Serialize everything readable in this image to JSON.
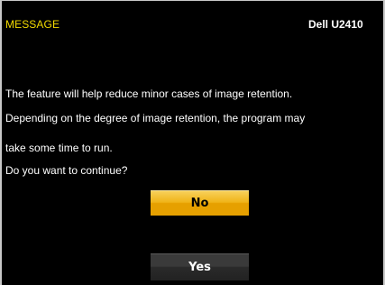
{
  "header": {
    "title": "MESSAGE",
    "model": "Dell U2410"
  },
  "message": {
    "line1": "The feature will help reduce minor cases of image retention.",
    "line2": "Depending on the degree of image retention, the program may",
    "line3": "take some time to run.",
    "line4": "Do you want to continue?"
  },
  "buttons": {
    "no_label": "No",
    "yes_label": "Yes"
  },
  "colors": {
    "background": "#000000",
    "title": "#f2d900",
    "selected_button": "#f0b419",
    "unselected_button": "#2a2a2a",
    "frame_border": "#c8c8c8"
  }
}
